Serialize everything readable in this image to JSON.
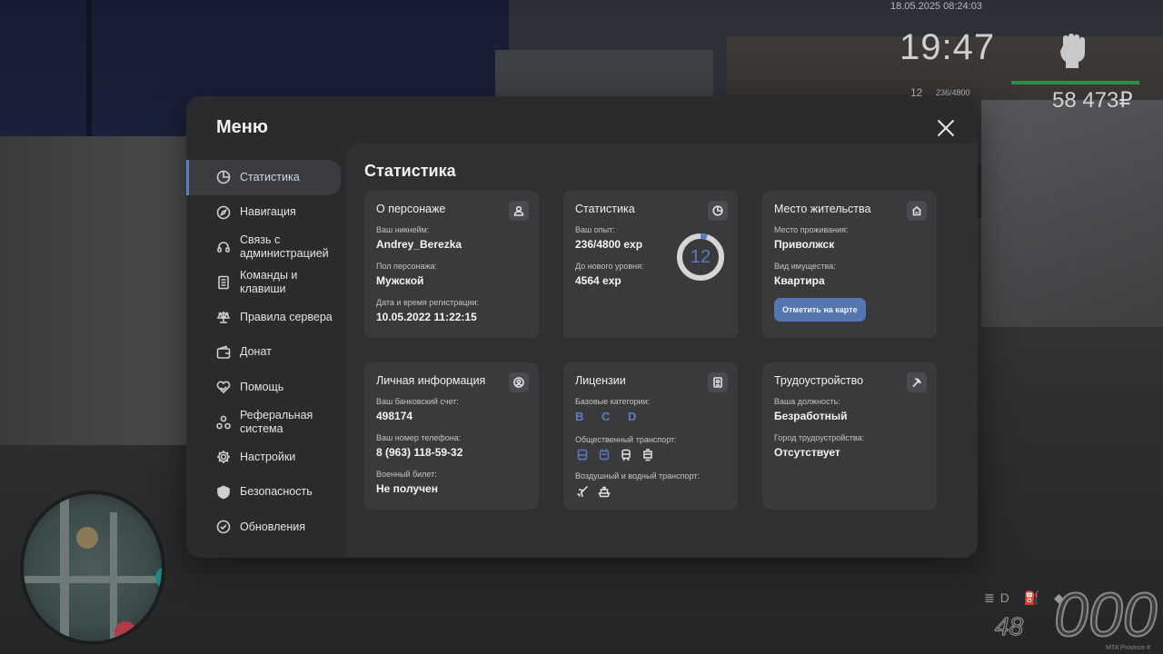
{
  "hud": {
    "date": "18.05.2025 08:24:03",
    "time": "19:47",
    "level": "12",
    "exp": "236/4800",
    "money": "58 473₽",
    "speed": "000",
    "fuel": "48",
    "watermark": "MTA Province #"
  },
  "menu": {
    "title": "Меню",
    "close_icon": "close-icon"
  },
  "sidebar": {
    "items": [
      {
        "label": "Статистика",
        "icon": "clock-pie-icon",
        "active": true
      },
      {
        "label": "Навигация",
        "icon": "compass-icon"
      },
      {
        "label": "Связь с администрацией",
        "icon": "headset-icon"
      },
      {
        "label": "Команды и клавиши",
        "icon": "document-icon"
      },
      {
        "label": "Правила сервера",
        "icon": "scales-icon"
      },
      {
        "label": "Донат",
        "icon": "wallet-icon"
      },
      {
        "label": "Помощь",
        "icon": "heart-hand-icon"
      },
      {
        "label": "Реферальная система",
        "icon": "network-icon"
      },
      {
        "label": "Настройки",
        "icon": "gear-icon"
      },
      {
        "label": "Безопасность",
        "icon": "shield-icon"
      },
      {
        "label": "Обновления",
        "icon": "check-circle-icon"
      }
    ]
  },
  "content": {
    "title": "Статистика",
    "character": {
      "title": "О персонаже",
      "nickname_label": "Ваш никнейм:",
      "nickname": "Andrey_Berezka",
      "gender_label": "Пол персонажа:",
      "gender": "Мужской",
      "reg_label": "Дата и время регистрации:",
      "reg": "10.05.2022 11:22:15"
    },
    "stats": {
      "title": "Статистика",
      "exp_label": "Ваш опыт:",
      "exp": "236/4800 exp",
      "next_label": "До нового уровня:",
      "next": "4564 exp",
      "level": "12",
      "progress": 0.049
    },
    "residence": {
      "title": "Место жительства",
      "place_label": "Место проживания:",
      "place": "Приволжск",
      "property_label": "Вид имущества:",
      "property": "Квартира",
      "button": "Отметить на карте"
    },
    "personal": {
      "title": "Личная информация",
      "bank_label": "Ваш банковский счет:",
      "bank": "498174",
      "phone_label": "Ваш номер телефона:",
      "phone": "8 (963) 118-59-32",
      "military_label": "Военный билет:",
      "military": "Не получен"
    },
    "licenses": {
      "title": "Лицензии",
      "basic_label": "Базовые категории:",
      "basic": "B C D",
      "public_label": "Общественный транспорт:",
      "air_label": "Воздушный и водный транспорт:"
    },
    "employment": {
      "title": "Трудоустройство",
      "position_label": "Ваша должность:",
      "position": "Безработный",
      "city_label": "Город трудоустройства:",
      "city": "Отсутствует"
    }
  },
  "colors": {
    "accent": "#5676b1",
    "panel": "#2b2b2d",
    "card": "#3a3a3d"
  }
}
